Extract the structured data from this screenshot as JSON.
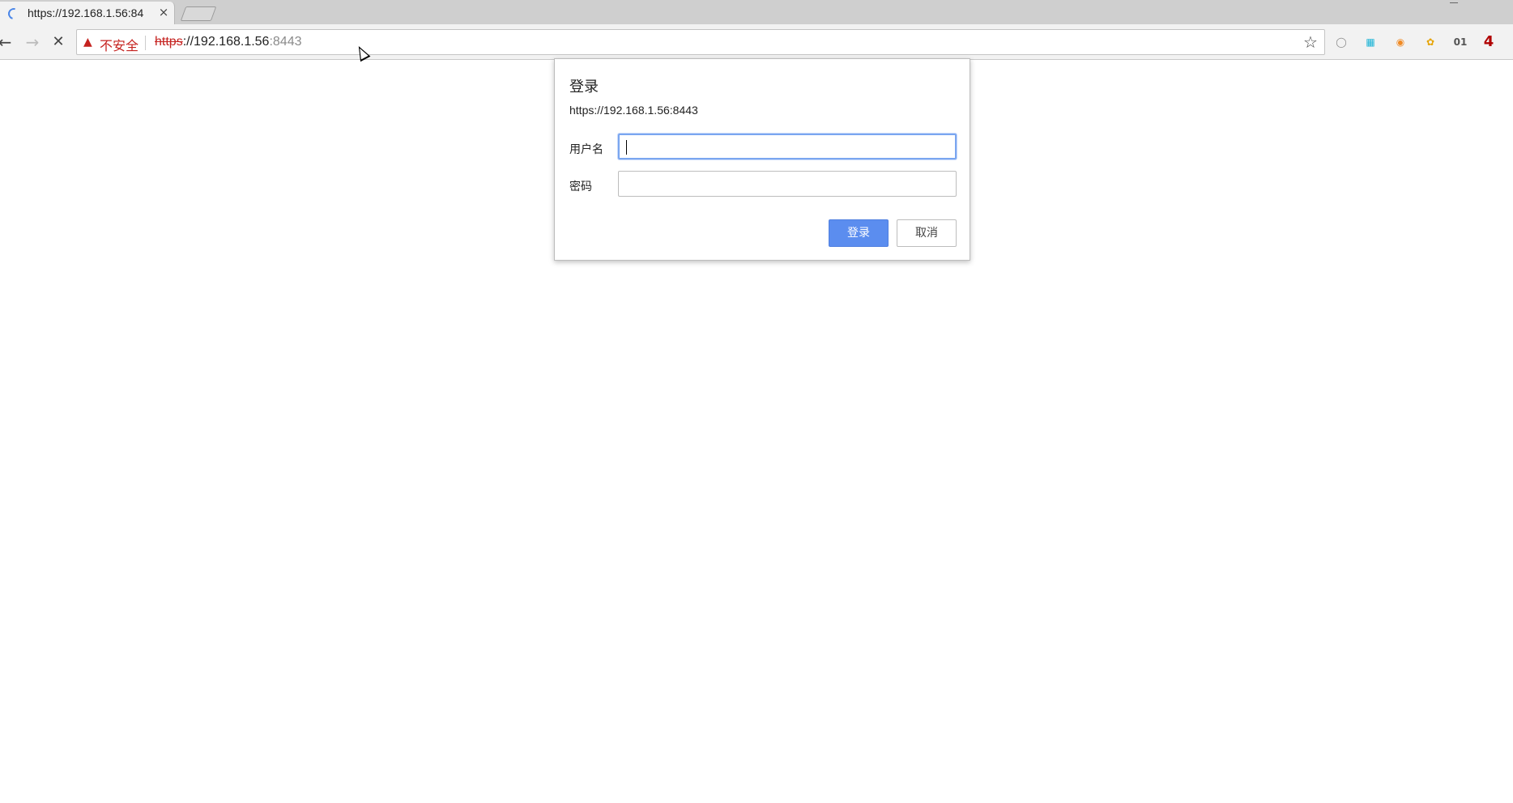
{
  "browser": {
    "tab": {
      "title": "https://192.168.1.56:84",
      "close_glyph": "×",
      "loading": true
    },
    "toolbar": {
      "back_glyph": "←",
      "forward_glyph": "→",
      "stop_glyph": "✕",
      "security_label": "不安全",
      "url_scheme": "https",
      "url_sep": "://",
      "url_host": "192.168.1.56",
      "url_port": ":8443",
      "bookmark_glyph": "☆",
      "extensions": [
        {
          "name": "circle-extension-icon",
          "glyph": "◯",
          "color": "#8a8a8a"
        },
        {
          "name": "qr-extension-icon",
          "glyph": "▦",
          "color": "#19b3d6"
        },
        {
          "name": "orange-extension-icon",
          "glyph": "◉",
          "color": "#f08a24"
        },
        {
          "name": "colorful-extension-icon",
          "glyph": "✿",
          "color": "#e6a300"
        },
        {
          "name": "01-extension-icon",
          "glyph": "01",
          "color": "#555555"
        },
        {
          "name": "4-extension-icon",
          "glyph": "4",
          "color": "#b00000"
        }
      ]
    }
  },
  "dialog": {
    "title": "登录",
    "origin": "https://192.168.1.56:8443",
    "username_label": "用户名",
    "username_value": "",
    "password_label": "密码",
    "password_value": "",
    "login_button": "登录",
    "cancel_button": "取消"
  },
  "colors": {
    "primary_button": "#5b8def",
    "security_warning": "#c5221f",
    "focus_ring": "#7aa6f0"
  }
}
